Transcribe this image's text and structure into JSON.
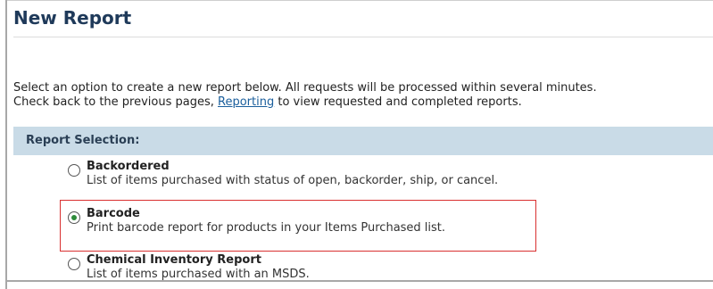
{
  "page": {
    "title": "New Report",
    "intro_line1": "Select an option to create a new report below. All requests will be processed within several minutes.",
    "intro_line2_before": "Check back to the previous pages, ",
    "intro_link": "Reporting",
    "intro_line2_after": " to view requested and completed reports."
  },
  "section": {
    "label": "Report Selection:"
  },
  "options": [
    {
      "label": "Backordered",
      "description": "List of items purchased with status of open, backorder, ship, or cancel.",
      "selected": false
    },
    {
      "label": "Barcode",
      "description": "Print barcode report for products in your Items Purchased list.",
      "selected": true
    },
    {
      "label": "Chemical Inventory Report",
      "description": "List of items purchased with an MSDS.",
      "selected": false
    }
  ],
  "colors": {
    "title": "#1f3a5a",
    "link": "#1a5e9c",
    "section_bar": "#c9dbe7",
    "highlight": "#d93030",
    "radio_selected": "#2e8b3a"
  }
}
